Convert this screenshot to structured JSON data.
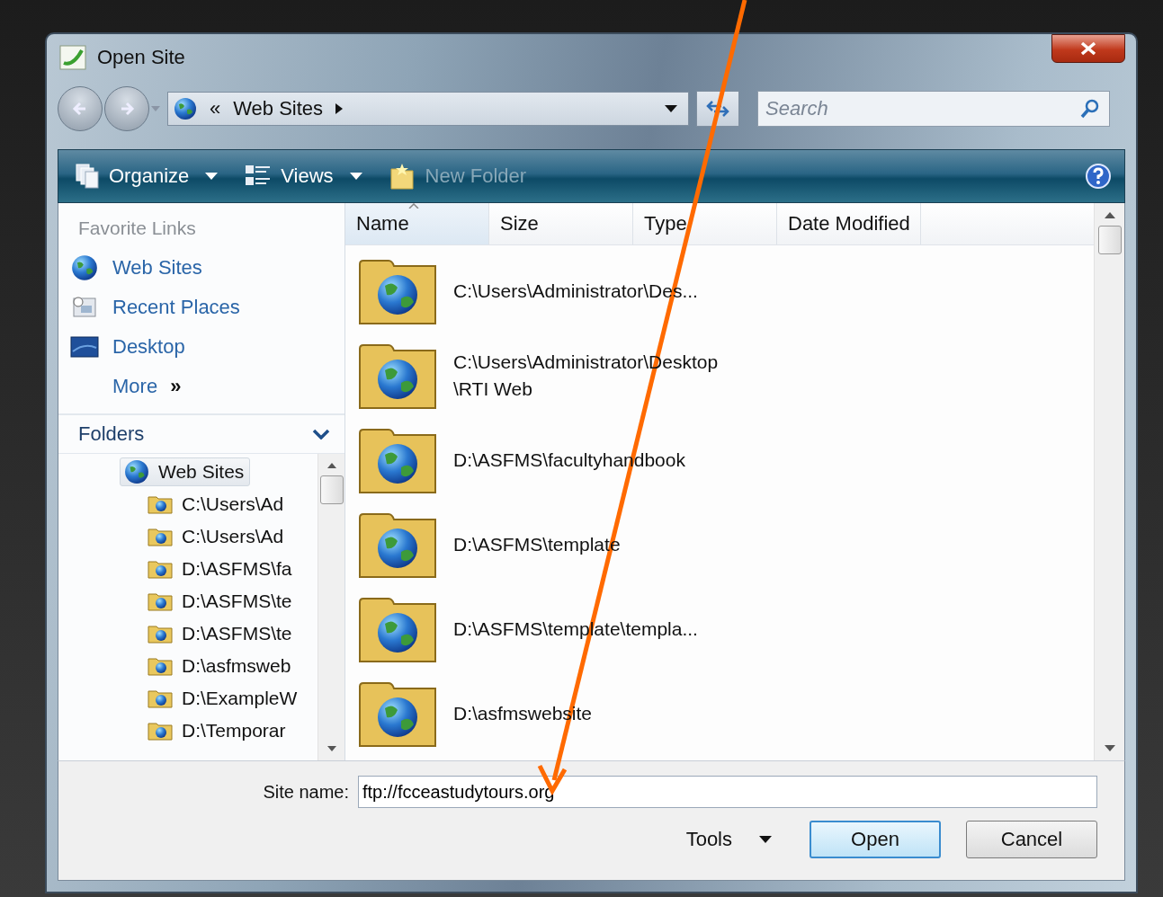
{
  "window": {
    "title": "Open Site"
  },
  "nav": {
    "overflow": "«",
    "location": "Web Sites",
    "search_placeholder": "Search"
  },
  "toolbar": [
    {
      "label": "Organize",
      "kind": "organize",
      "dropdown": true,
      "disabled": false
    },
    {
      "label": "Views",
      "kind": "views",
      "dropdown": true,
      "disabled": false
    },
    {
      "label": "New Folder",
      "kind": "newfolder",
      "dropdown": false,
      "disabled": true
    }
  ],
  "favorite_links": {
    "title": "Favorite Links",
    "items": [
      {
        "label": "Web Sites",
        "kind": "globe"
      },
      {
        "label": "Recent Places",
        "kind": "recent"
      },
      {
        "label": "Desktop",
        "kind": "desktop"
      },
      {
        "label": "More",
        "kind": "more",
        "glyph": "»"
      }
    ]
  },
  "folders": {
    "title": "Folders",
    "expanded": true,
    "tree": [
      {
        "label": "Web Sites",
        "selected": true,
        "children": [
          {
            "label": "C:\\Users\\Ad",
            "selected": false
          },
          {
            "label": "C:\\Users\\Ad",
            "selected": false
          },
          {
            "label": "D:\\ASFMS\\fa",
            "selected": false
          },
          {
            "label": "D:\\ASFMS\\te",
            "selected": false
          },
          {
            "label": "D:\\ASFMS\\te",
            "selected": false
          },
          {
            "label": "D:\\asfmsweb",
            "selected": false
          },
          {
            "label": "D:\\ExampleW",
            "selected": false
          },
          {
            "label": "D:\\Temporar",
            "selected": false
          }
        ]
      }
    ]
  },
  "columns": [
    {
      "label": "Name",
      "sorted": true
    },
    {
      "label": "Size",
      "sorted": false
    },
    {
      "label": "Type",
      "sorted": false
    },
    {
      "label": "Date Modified",
      "sorted": false
    }
  ],
  "files": [
    {
      "name": "C:\\Users\\Administrator\\Des..."
    },
    {
      "name": "C:\\Users\\Administrator\\Desktop\\RTI Web"
    },
    {
      "name": "D:\\ASFMS\\facultyhandbook"
    },
    {
      "name": "D:\\ASFMS\\template"
    },
    {
      "name": "D:\\ASFMS\\template\\templa..."
    },
    {
      "name": "D:\\asfmswebsite"
    }
  ],
  "site_name": {
    "label": "Site name:",
    "value": "ftp://fcceastudytours.org"
  },
  "buttons": [
    {
      "label": "Tools",
      "kind": "menu"
    },
    {
      "label": "Open",
      "kind": "button",
      "default": true
    },
    {
      "label": "Cancel",
      "kind": "button",
      "default": false
    }
  ]
}
